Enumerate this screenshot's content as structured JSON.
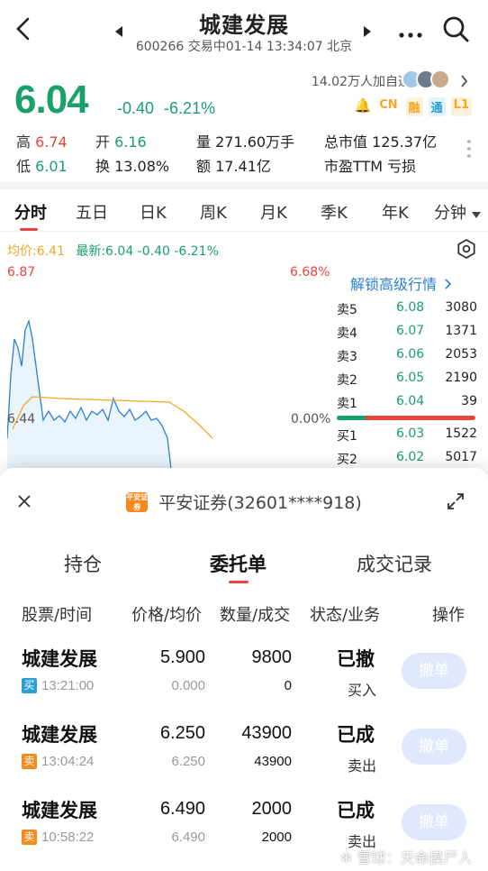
{
  "header": {
    "title": "城建发展",
    "subtitle": "600266 交易中01-14 13:34:07 北京"
  },
  "quote": {
    "price": "6.04",
    "change": "-0.40",
    "change_pct": "-6.21%",
    "followers": "14.02万人加自选",
    "badges": [
      "CN",
      "融",
      "通",
      "L1"
    ]
  },
  "stats": {
    "high_label": "高",
    "high": "6.74",
    "open_label": "开",
    "open": "6.16",
    "volume": "量 271.60万手",
    "market_cap": "总市值 125.37亿",
    "low_label": "低",
    "low": "6.01",
    "turnover": "换 13.08%",
    "amount": "额 17.41亿",
    "pe": "市盈TTM 亏损"
  },
  "period_tabs": [
    "分时",
    "五日",
    "日K",
    "周K",
    "月K",
    "季K",
    "年K",
    "分钟"
  ],
  "chart": {
    "avg": "均价:6.41",
    "latest": "最新:6.04 -0.40 -6.21%",
    "top_price": "6.87",
    "top_pct": "6.68%",
    "mid_price": "6.44",
    "mid_pct": "0.00%",
    "unlock": "解锁高级行情"
  },
  "orderbook": [
    {
      "label": "卖5",
      "price": "6.08",
      "vol": "3080"
    },
    {
      "label": "卖4",
      "price": "6.07",
      "vol": "1371"
    },
    {
      "label": "卖3",
      "price": "6.06",
      "vol": "2053"
    },
    {
      "label": "卖2",
      "price": "6.05",
      "vol": "2190"
    },
    {
      "label": "卖1",
      "price": "6.04",
      "vol": "39"
    },
    {
      "label": "买1",
      "price": "6.03",
      "vol": "1522"
    },
    {
      "label": "买2",
      "price": "6.02",
      "vol": "5017"
    }
  ],
  "sheet": {
    "broker_logo": "平安证券",
    "broker": "平安证券(32601****918)",
    "tabs": [
      "持仓",
      "委托单",
      "成交记录"
    ],
    "columns": [
      "股票/时间",
      "价格/均价",
      "数量/成交",
      "状态/业务",
      "操作"
    ],
    "orders": [
      {
        "name": "城建发展",
        "side": "买",
        "time": "13:21:00",
        "price": "5.900",
        "avg": "0.000",
        "qty": "9800",
        "filled": "0",
        "status": "已撤",
        "biz": "买入",
        "action": "撤单"
      },
      {
        "name": "城建发展",
        "side": "卖",
        "time": "13:04:24",
        "price": "6.250",
        "avg": "6.250",
        "qty": "43900",
        "filled": "43900",
        "status": "已成",
        "biz": "卖出",
        "action": "撤单"
      },
      {
        "name": "城建发展",
        "side": "卖",
        "time": "10:58:22",
        "price": "6.490",
        "avg": "6.490",
        "qty": "2000",
        "filled": "2000",
        "status": "已成",
        "biz": "卖出",
        "action": "撤单"
      }
    ]
  },
  "watermark": "雪球：天命摸尸人",
  "colors": {
    "green": "#1aa06a",
    "red": "#e6463c",
    "accent_orange": "#f5a623",
    "button_bg": "#dfe9fb"
  }
}
